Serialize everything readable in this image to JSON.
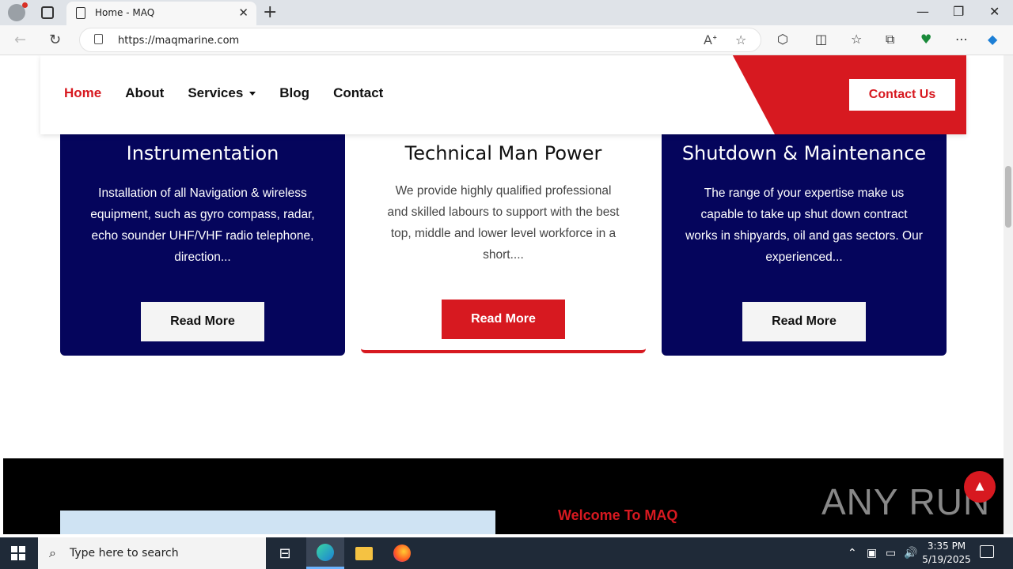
{
  "browser": {
    "tab_title": "Home - MAQ",
    "url": "https://maqmarine.com",
    "icons": [
      "profile-icon",
      "tab-actions-icon",
      "page-icon",
      "close-icon",
      "new-tab-icon",
      "back-icon",
      "refresh-icon",
      "lock-icon",
      "read-aloud-icon",
      "favorite-icon",
      "extensions-icon",
      "split-screen-icon",
      "favorites-icon",
      "collections-icon",
      "performance-icon",
      "more-icon",
      "copilot-icon",
      "minimize-icon",
      "restore-icon",
      "window-close-icon"
    ]
  },
  "site": {
    "nav": {
      "items": [
        {
          "label": "Home"
        },
        {
          "label": "About"
        },
        {
          "label": "Services"
        },
        {
          "label": "Blog"
        },
        {
          "label": "Contact"
        }
      ],
      "cta": "Contact Us"
    },
    "cards": [
      {
        "title": "Instrumentation",
        "desc": "Installation of all Navigation & wireless equipment, such as gyro compass, radar, echo sounder UHF/VHF radio telephone, direction...",
        "button": "Read More"
      },
      {
        "title": "Technical Man Power",
        "desc": "We provide highly qualified professional and skilled labours to support with the best top, middle and lower level workforce in a short....",
        "button": "Read More"
      },
      {
        "title": "Shutdown & Maintenance",
        "desc": "The range of your expertise make us capable to take up shut down contract works in shipyards, oil and gas sectors. Our experienced...",
        "button": "Read More"
      }
    ],
    "welcome": "Welcome To MAQ",
    "watermark": "ANY RUN"
  },
  "colors": {
    "brand_red": "#d71920",
    "card_navy": "#05055c"
  },
  "taskbar": {
    "search_placeholder": "Type here to search",
    "time": "3:35 PM",
    "date": "5/19/2025"
  }
}
